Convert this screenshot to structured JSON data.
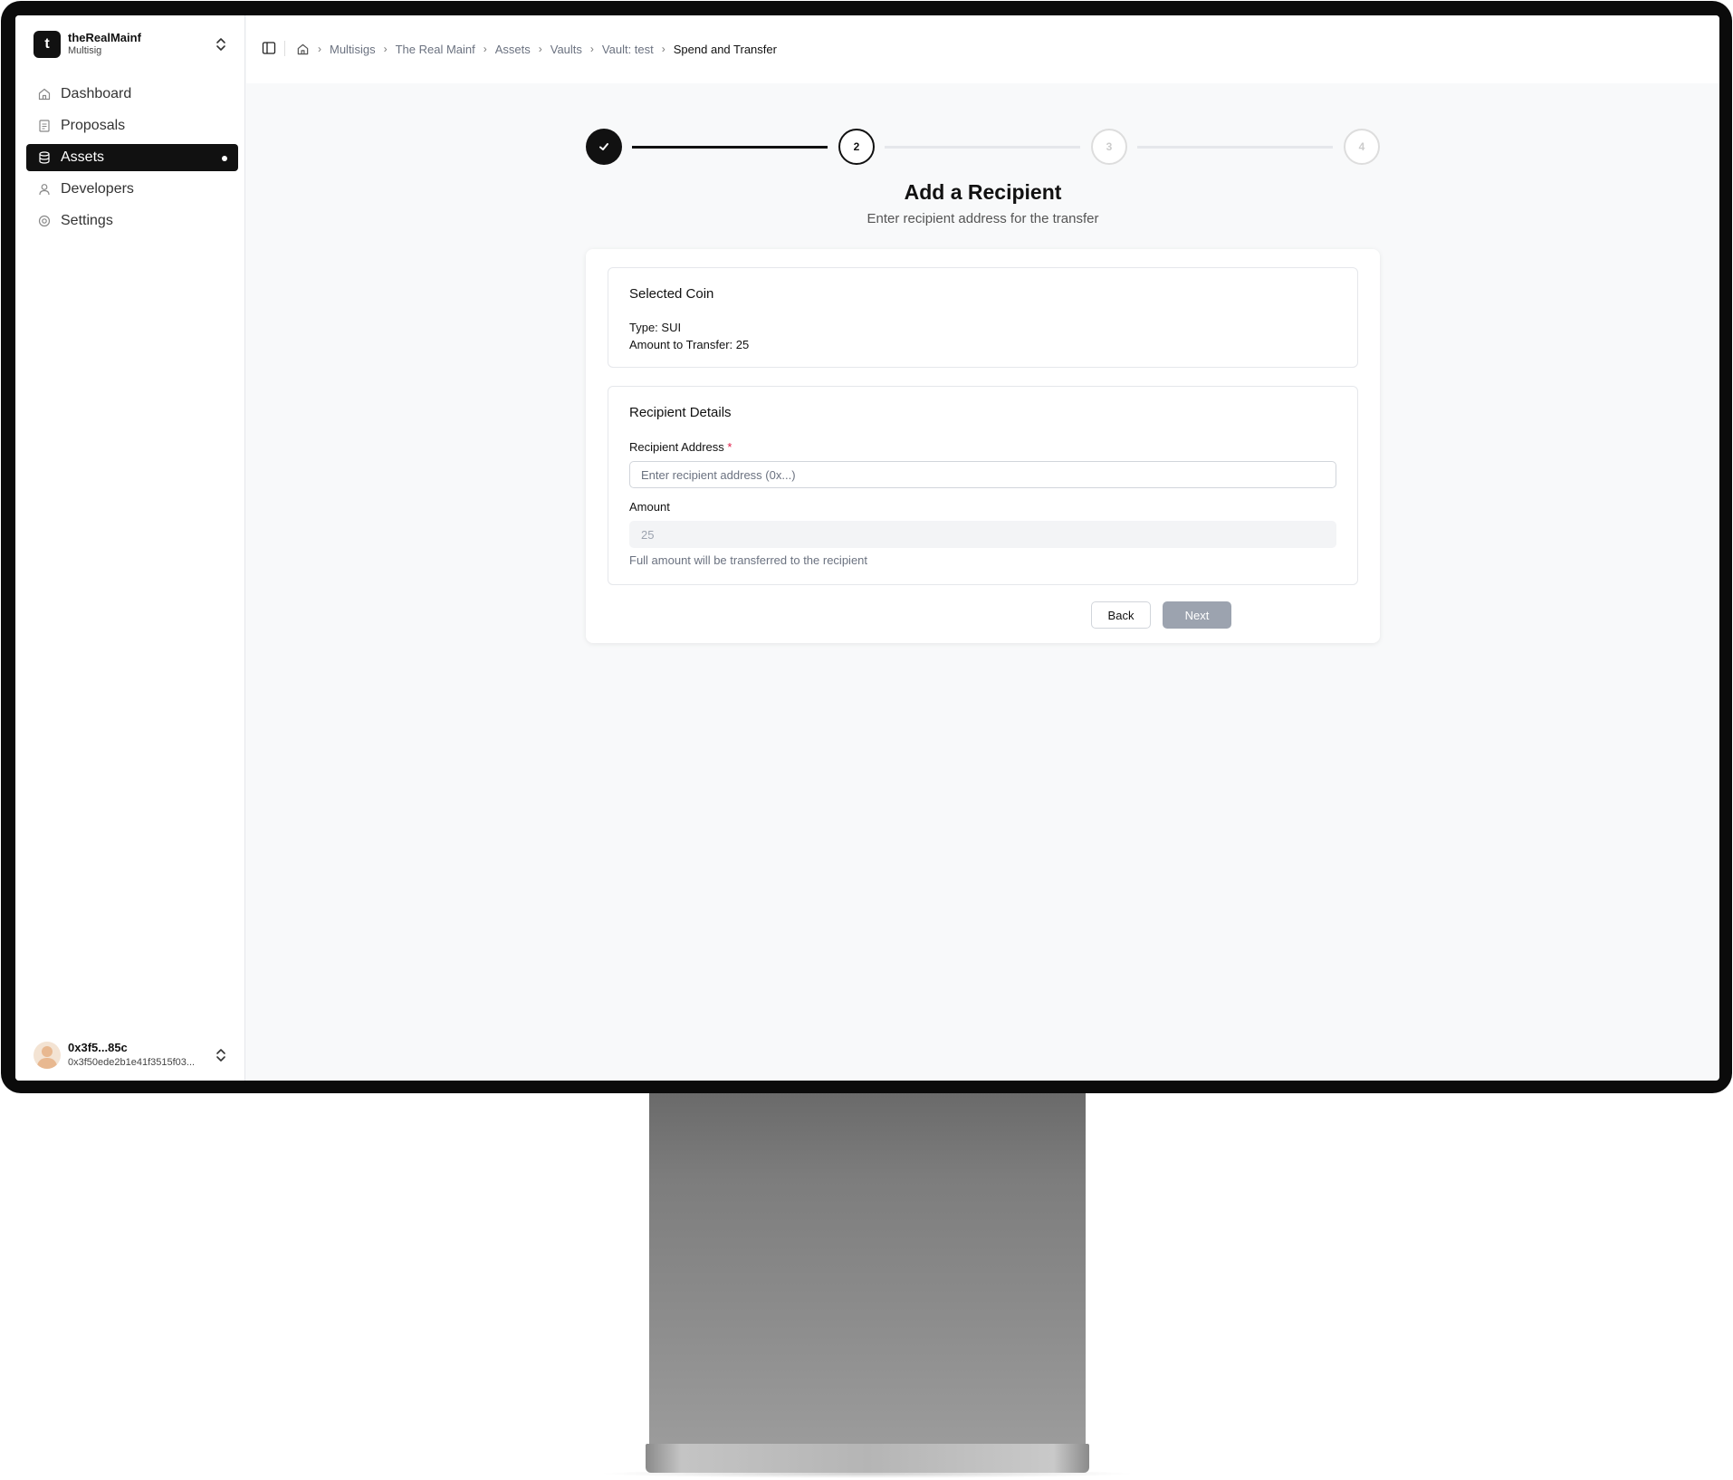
{
  "org": {
    "avatar_letter": "t",
    "name": "theRealMainf",
    "type": "Multisig"
  },
  "nav": {
    "items": [
      {
        "label": "Dashboard",
        "icon": "home-icon",
        "active": false
      },
      {
        "label": "Proposals",
        "icon": "document-icon",
        "active": false
      },
      {
        "label": "Assets",
        "icon": "database-icon",
        "active": true
      },
      {
        "label": "Developers",
        "icon": "user-icon",
        "active": false
      },
      {
        "label": "Settings",
        "icon": "settings-icon",
        "active": false
      }
    ]
  },
  "user": {
    "short": "0x3f5...85c",
    "address": "0x3f50ede2b1e41f3515f03..."
  },
  "breadcrumbs": [
    "Multisigs",
    "The Real Mainf",
    "Assets",
    "Vaults",
    "Vault: test",
    "Spend and Transfer"
  ],
  "stepper": {
    "current": 2,
    "steps": [
      "1",
      "2",
      "3",
      "4"
    ]
  },
  "page": {
    "title": "Add a Recipient",
    "subtitle": "Enter recipient address for the transfer"
  },
  "selected_coin": {
    "title": "Selected Coin",
    "type_line": "Type: SUI",
    "amount_line": "Amount to Transfer: 25"
  },
  "recipient": {
    "title": "Recipient Details",
    "address_label": "Recipient Address",
    "required_mark": "*",
    "address_placeholder": "Enter recipient address (0x...)",
    "address_value": "",
    "amount_label": "Amount",
    "amount_value": "25",
    "hint": "Full amount will be transferred to the recipient"
  },
  "actions": {
    "back": "Back",
    "next": "Next"
  },
  "colors": {
    "primary": "#111111",
    "disabled_button": "#9ca3af",
    "required": "#e11d48",
    "background": "#f8f9fa"
  }
}
